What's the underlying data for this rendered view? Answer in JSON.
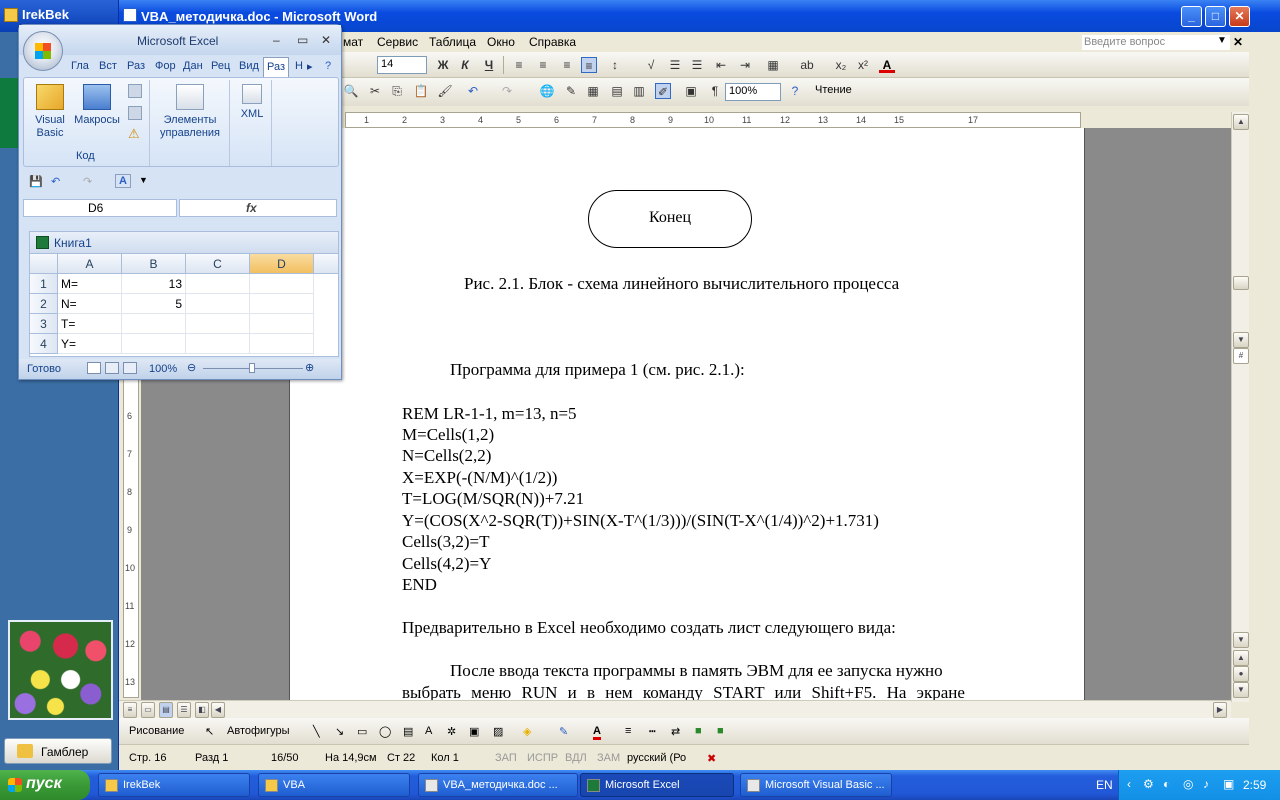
{
  "desktop": {
    "top_window_title": "IrekBek",
    "gambler_label": "Гамблер"
  },
  "word": {
    "title": "VBA_методичка.doc - Microsoft Word",
    "menu": [
      "мат",
      "Сервис",
      "Таблица",
      "Окно",
      "Справка"
    ],
    "help_placeholder": "Введите вопрос",
    "font_size": "14",
    "zoom": "100%",
    "reading_label": "Чтение",
    "ruler_numbers": [
      "1",
      "2",
      "3",
      "4",
      "5",
      "6",
      "7",
      "8",
      "9",
      "10",
      "11",
      "12",
      "13",
      "14",
      "15",
      "17"
    ],
    "vruler_numbers": [
      "6",
      "7",
      "8",
      "9",
      "10",
      "11",
      "12",
      "13"
    ],
    "document": {
      "end_label": "Конец",
      "caption": "Рис. 2.1. Блок - схема линейного вычислительного процесса",
      "program_intro": "Программа для примера 1 (см. рис. 2.1.):",
      "code": [
        "REM LR-1-1, m=13, n=5",
        "M=Cells(1,2)",
        "N=Cells(2,2)",
        "X=EXP(-(N/M)^(1/2))",
        "T=LOG(M/SQR(N))+7.21",
        "Y=(COS(X^2-SQR(T))+SIN(X-T^(1/3)))/(SIN(T-X^(1/4))^2)+1.731)",
        "Cells(3,2)=T",
        "Cells(4,2)=Y",
        "END"
      ],
      "para1": "Предварительно в Excel необходимо создать лист следующего вида:",
      "para2_line1": "После ввода текста программы в память ЭВМ для ее запуска нужно",
      "para2_line2": "выбрать меню RUN и в нем команду START или Shift+F5. На экране"
    },
    "drawing_toolbar": {
      "draw_label": "Рисование",
      "autoshapes_label": "Автофигуры"
    },
    "status": {
      "page": "Стр. 16",
      "section": "Разд 1",
      "pages": "16/50",
      "at": "На 14,9см",
      "line": "Ст 22",
      "col": "Кол 1",
      "rec": "ЗАП",
      "trk": "ИСПР",
      "ext": "ВДЛ",
      "ovr": "ЗАМ",
      "language": "русский (Ро"
    }
  },
  "excel": {
    "title": "Microsoft Excel",
    "tabs": [
      "Гла",
      "Вст",
      "Раз",
      "Фор",
      "Дан",
      "Рец",
      "Вид",
      "Раз",
      "Н"
    ],
    "ribbon": {
      "visual_basic": "Visual Basic",
      "macros": "Макросы",
      "controls": "Элементы управления",
      "xml": "XML",
      "group_code": "Код"
    },
    "name_box": "D6",
    "fx_label": "fx",
    "workbook_title": "Книга1",
    "columns": [
      "A",
      "B",
      "C",
      "D"
    ],
    "rows": [
      {
        "n": "1",
        "a": "M=",
        "b": "13"
      },
      {
        "n": "2",
        "a": "N=",
        "b": "5"
      },
      {
        "n": "3",
        "a": "T=",
        "b": ""
      },
      {
        "n": "4",
        "a": "Y=",
        "b": ""
      }
    ],
    "status_ready": "Готово",
    "zoom": "100%"
  },
  "taskbar": {
    "start_label": "пуск",
    "tasks": [
      "IrekBek",
      "VBA",
      "VBA_методичка.doc ...",
      "Microsoft Excel",
      "Microsoft Visual Basic ..."
    ],
    "lang": "EN",
    "clock": "2:59"
  }
}
